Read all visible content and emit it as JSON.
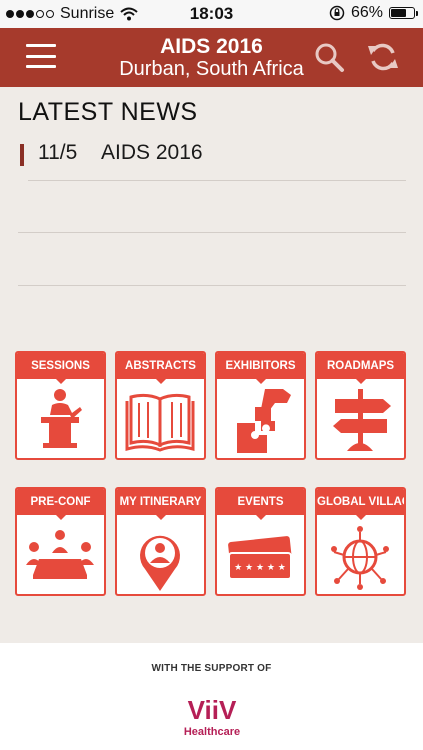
{
  "status_bar": {
    "carrier": "Sunrise",
    "time": "18:03",
    "battery": "66%",
    "battery_level": 0.66
  },
  "header": {
    "title": "AIDS 2016",
    "subtitle": "Durban, South Africa"
  },
  "news": {
    "section_title": "LATEST NEWS",
    "items": [
      {
        "date": "11/5",
        "title": "AIDS 2016"
      }
    ]
  },
  "tiles": [
    {
      "label": "SESSIONS",
      "icon": "speaker-podium-icon"
    },
    {
      "label": "ABSTRACTS",
      "icon": "open-book-icon"
    },
    {
      "label": "EXHIBITORS",
      "icon": "puzzle-hand-icon"
    },
    {
      "label": "ROADMAPS",
      "icon": "signpost-icon"
    },
    {
      "label": "PRE-CONF",
      "icon": "meeting-table-icon"
    },
    {
      "label": "MY ITINERARY",
      "icon": "user-pin-icon"
    },
    {
      "label": "EVENTS",
      "icon": "tickets-icon"
    },
    {
      "label": "GLOBAL VILLAGE",
      "icon": "globe-people-icon"
    }
  ],
  "footer": {
    "support_text": "WITH THE SUPPORT OF",
    "logo_main": "ViiV",
    "logo_sub": "Healthcare"
  },
  "colors": {
    "navbar": "#a63a2c",
    "accent": "#e64a3c",
    "background": "#efebe7"
  }
}
